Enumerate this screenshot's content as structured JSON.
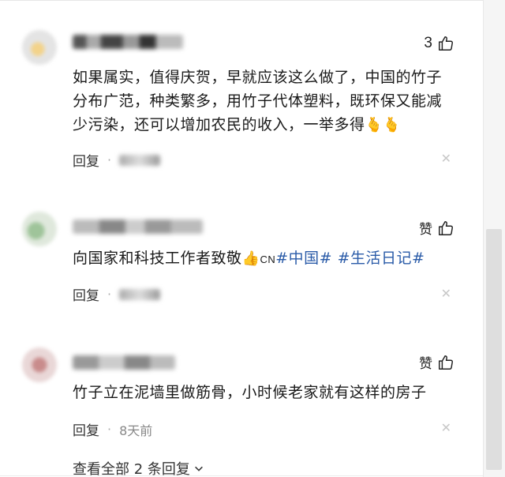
{
  "comments": [
    {
      "like_count": "3",
      "text_parts": [
        "如果属实，值得庆贺，早就应该这么做了，中国的竹子分布广范，种类繁多，用竹子代体塑料，既环保又能减少污染，还可以增加农民的收入，一举多得",
        "🫰🫰"
      ],
      "reply_label": "回复",
      "separator": "·"
    },
    {
      "like_label": "赞",
      "text_prefix": "向国家和科技工作者致敬",
      "thumb_emoji": "👍",
      "cn_label": "CN",
      "hashtags": [
        "#中国#",
        "#生活日记#"
      ],
      "reply_label": "回复",
      "separator": "·"
    },
    {
      "like_label": "赞",
      "text": "竹子立在泥墙里做筋骨，小时候老家就有这样的房子",
      "reply_label": "回复",
      "separator": "·",
      "time": "8天前"
    }
  ],
  "footer": {
    "view_all": "查看全部 2 条回复"
  },
  "icons": {
    "like": "thumbs-up-outline-icon",
    "close": "close-icon",
    "chevron": "chevron-down-icon"
  },
  "colors": {
    "hashtag": "#2a5ba8",
    "text": "#1a1a1a",
    "muted": "#888888"
  }
}
